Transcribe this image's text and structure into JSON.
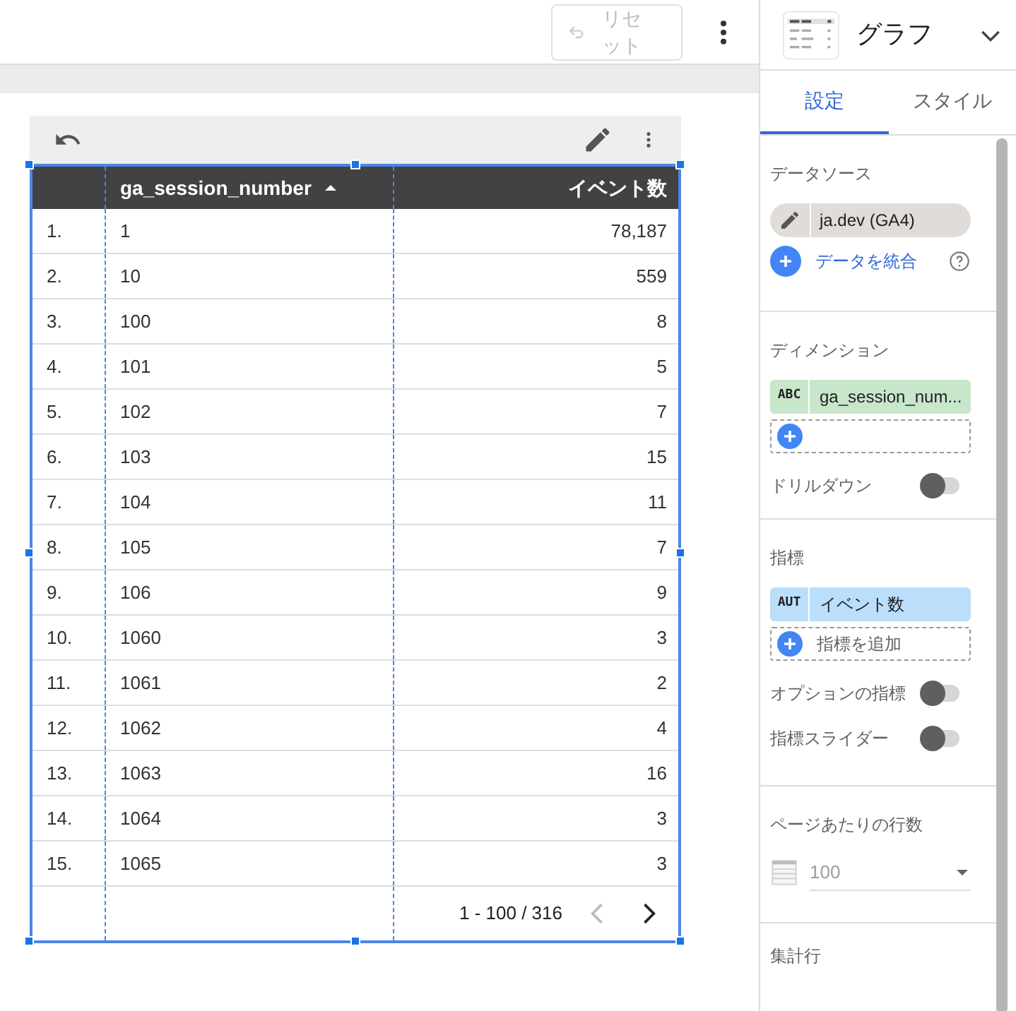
{
  "top_bar": {
    "reset_button": {
      "label": "リセット",
      "disabled": true
    }
  },
  "chart": {
    "columns": [
      {
        "label": "ga_session_number",
        "sort_ascending": true
      },
      {
        "label": "イベント数"
      }
    ],
    "rows": [
      {
        "index": "1.",
        "dimension": "1",
        "value": "78,187"
      },
      {
        "index": "2.",
        "dimension": "10",
        "value": "559"
      },
      {
        "index": "3.",
        "dimension": "100",
        "value": "8"
      },
      {
        "index": "4.",
        "dimension": "101",
        "value": "5"
      },
      {
        "index": "5.",
        "dimension": "102",
        "value": "7"
      },
      {
        "index": "6.",
        "dimension": "103",
        "value": "15"
      },
      {
        "index": "7.",
        "dimension": "104",
        "value": "11"
      },
      {
        "index": "8.",
        "dimension": "105",
        "value": "7"
      },
      {
        "index": "9.",
        "dimension": "106",
        "value": "9"
      },
      {
        "index": "10.",
        "dimension": "1060",
        "value": "3"
      },
      {
        "index": "11.",
        "dimension": "1061",
        "value": "2"
      },
      {
        "index": "12.",
        "dimension": "1062",
        "value": "4"
      },
      {
        "index": "13.",
        "dimension": "1063",
        "value": "16"
      },
      {
        "index": "14.",
        "dimension": "1064",
        "value": "3"
      },
      {
        "index": "15.",
        "dimension": "1065",
        "value": "3"
      }
    ],
    "pagination": {
      "range": "1 - 100 / 316",
      "prev_disabled": true,
      "next_disabled": false
    }
  },
  "panel": {
    "title": "グラフ",
    "tabs": [
      {
        "label": "設定",
        "selected": true
      },
      {
        "label": "スタイル",
        "selected": false
      }
    ],
    "data_source": {
      "heading": "データソース",
      "source": "ja.dev (GA4)",
      "blend_link": "データを統合"
    },
    "dimension": {
      "heading": "ディメンション",
      "fields": [
        {
          "kind": "dimension",
          "badge": "ABC",
          "name": "ga_session_num..."
        }
      ],
      "toggles": [
        {
          "label": "ドリルダウン",
          "on": false
        }
      ]
    },
    "metric": {
      "heading": "指標",
      "fields": [
        {
          "kind": "metric",
          "badge": "AUT",
          "name": "イベント数"
        }
      ],
      "add_label": "指標を追加",
      "toggles": [
        {
          "label": "オプションの指標",
          "on": false
        },
        {
          "label": "指標スライダー",
          "on": false
        }
      ]
    },
    "rows_per_page": {
      "heading": "ページあたりの行数",
      "value": "100"
    },
    "next_section": {
      "heading": "集計行"
    }
  }
}
